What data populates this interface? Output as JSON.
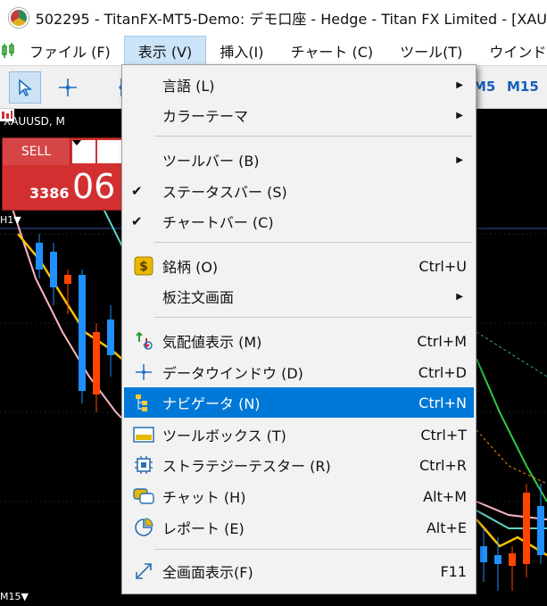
{
  "window": {
    "title": "502295 - TitanFX-MT5-Demo: デモ口座 - Hedge - Titan FX Limited - [XAU"
  },
  "menubar": {
    "items": [
      "ファイル (F)",
      "表示 (V)",
      "挿入(I)",
      "チャート (C)",
      "ツール(T)",
      "ウインドウ"
    ],
    "active_index": 1
  },
  "toolbar": {
    "timeframes": [
      "M5",
      "M15"
    ]
  },
  "chart": {
    "symbol": "XAUUSD, M",
    "sell_label": "SELL",
    "price_small": "3386",
    "price_big": "06",
    "period_label_top": "H1▼",
    "period_label_bottom": "M15▼",
    "colors": {
      "bull": "#1e90ff",
      "bear": "#ff4500",
      "ma": "#ffc000"
    }
  },
  "view_menu": {
    "items": [
      {
        "label": "言語 (L)",
        "submenu": true
      },
      {
        "label": "カラーテーマ",
        "submenu": true
      },
      {
        "label": "ツールバー (B)",
        "submenu": true
      },
      {
        "label": "ステータスバー (S)",
        "checked": true
      },
      {
        "label": "チャートバー (C)",
        "checked": true
      },
      {
        "label": "銘柄 (O)",
        "shortcut": "Ctrl+U",
        "icon": "dollar-icon"
      },
      {
        "label": "板注文画面",
        "submenu": true
      },
      {
        "label": "気配値表示 (M)",
        "shortcut": "Ctrl+M",
        "icon": "market-watch-icon"
      },
      {
        "label": "データウインドウ (D)",
        "shortcut": "Ctrl+D",
        "icon": "crosshair-icon"
      },
      {
        "label": "ナビゲータ (N)",
        "shortcut": "Ctrl+N",
        "icon": "navigator-icon",
        "highlighted": true
      },
      {
        "label": "ツールボックス (T)",
        "shortcut": "Ctrl+T",
        "icon": "toolbox-icon"
      },
      {
        "label": "ストラテジーテスター (R)",
        "shortcut": "Ctrl+R",
        "icon": "chip-icon"
      },
      {
        "label": "チャット (H)",
        "shortcut": "Alt+M",
        "icon": "chat-icon"
      },
      {
        "label": "レポート (E)",
        "shortcut": "Alt+E",
        "icon": "report-icon"
      },
      {
        "label": "全画面表示(F)",
        "shortcut": "F11",
        "icon": "fullscreen-icon"
      }
    ]
  }
}
